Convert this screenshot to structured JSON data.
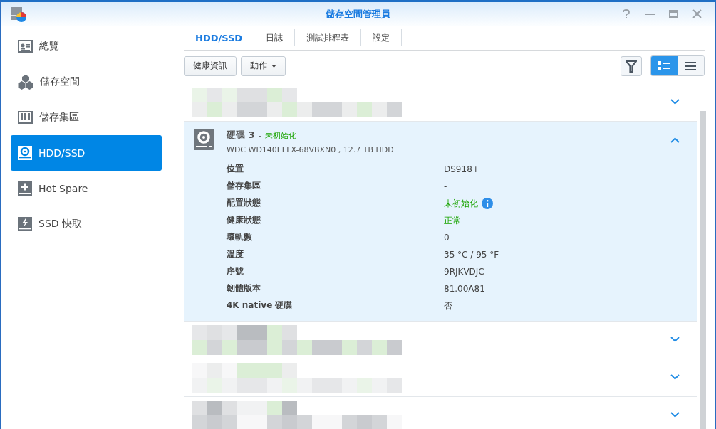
{
  "window": {
    "title": "儲存空間管理員"
  },
  "sidebar": {
    "items": [
      {
        "label": "總覽",
        "selected": false
      },
      {
        "label": "儲存空間",
        "selected": false
      },
      {
        "label": "儲存集區",
        "selected": false
      },
      {
        "label": "HDD/SSD",
        "selected": true
      },
      {
        "label": "Hot Spare",
        "selected": false
      },
      {
        "label": "SSD 快取",
        "selected": false
      }
    ]
  },
  "tabs": [
    {
      "label": "HDD/SSD",
      "selected": true
    },
    {
      "label": "日誌",
      "selected": false
    },
    {
      "label": "測試排程表",
      "selected": false
    },
    {
      "label": "設定",
      "selected": false
    }
  ],
  "toolbar": {
    "buttons": [
      {
        "label": "健康資訊",
        "dropdown": false
      },
      {
        "label": "動作",
        "dropdown": true
      }
    ],
    "view_mode": [
      {
        "kind": "detail",
        "selected": true
      },
      {
        "kind": "list",
        "selected": false
      }
    ]
  },
  "disks": [
    {
      "kind": "redacted",
      "expanded": false
    },
    {
      "kind": "disk",
      "expanded": true,
      "name": "硬碟 3",
      "separator": "-",
      "status": "未初始化",
      "model": "WDC WD140EFFX-68VBXN0 , 12.7 TB HDD",
      "details": [
        {
          "label": "位置",
          "value": "DS918+",
          "kind": "plain"
        },
        {
          "label": "儲存集區",
          "value": "-",
          "kind": "plain"
        },
        {
          "label": "配置狀態",
          "value": "未初始化",
          "kind": "status_info"
        },
        {
          "label": "健康狀態",
          "value": "正常",
          "kind": "status"
        },
        {
          "label": "壞軌數",
          "value": "0",
          "kind": "plain"
        },
        {
          "label": "溫度",
          "value": "35 °C / 95 °F",
          "kind": "plain"
        },
        {
          "label": "序號",
          "value": "9RJKVDJC",
          "kind": "plain"
        },
        {
          "label": "韌體版本",
          "value": "81.00A81",
          "kind": "plain"
        },
        {
          "label": "4K native 硬碟",
          "value": "否",
          "kind": "plain"
        }
      ]
    },
    {
      "kind": "redacted",
      "expanded": false
    },
    {
      "kind": "redacted",
      "expanded": false
    },
    {
      "kind": "redacted",
      "expanded": false
    }
  ]
}
